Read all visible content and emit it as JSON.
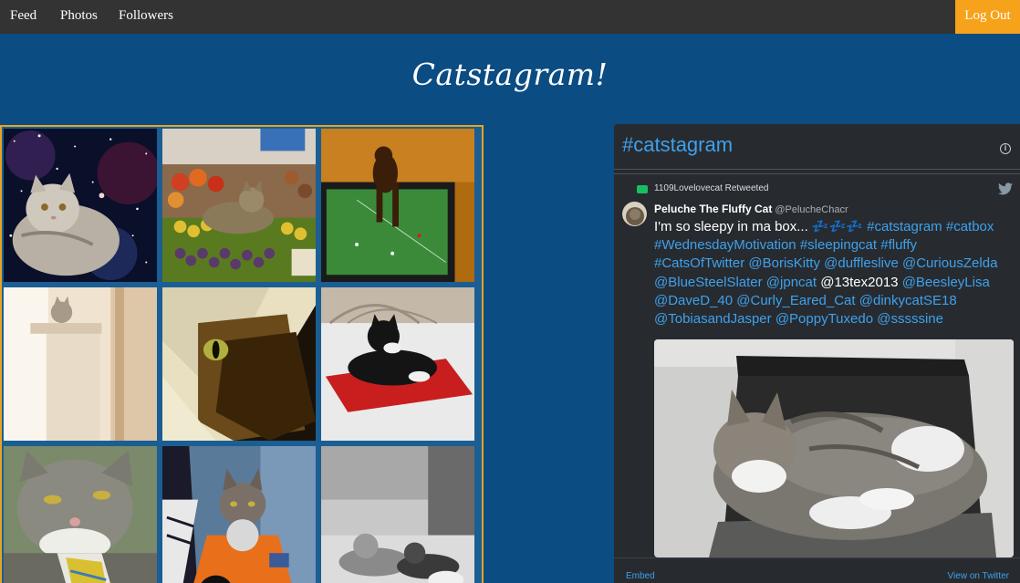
{
  "nav": {
    "items": [
      {
        "label": "Feed"
      },
      {
        "label": "Photos"
      },
      {
        "label": "Followers"
      }
    ],
    "logout_label": "Log Out"
  },
  "site_title": "Catstagram!",
  "photo_grid": {
    "photos": [
      {
        "description": "cat in space"
      },
      {
        "description": "cat on fruit stand"
      },
      {
        "description": "cat on tv"
      },
      {
        "description": "cat in cat tree"
      },
      {
        "description": "cat eye peeking"
      },
      {
        "description": "cat in box"
      },
      {
        "description": "cat with tie"
      },
      {
        "description": "astronaut cat"
      },
      {
        "description": "kittens black and white"
      }
    ]
  },
  "twitter_widget": {
    "title": "#catstagram",
    "retweet_text": "1109Lovelovecat Retweeted",
    "author_name": "Peluche The Fluffy Cat",
    "author_handle": "@PelucheChacr",
    "tweet_segments": [
      {
        "text": "I'm so sleepy in ma box... 💤💤💤 ",
        "link": false
      },
      {
        "text": "#catstagram",
        "link": true
      },
      {
        "text": " ",
        "link": false
      },
      {
        "text": "#catbox",
        "link": true
      },
      {
        "text": " ",
        "link": false
      },
      {
        "text": "#WednesdayMotivation",
        "link": true
      },
      {
        "text": " ",
        "link": false
      },
      {
        "text": "#sleepingcat",
        "link": true
      },
      {
        "text": " ",
        "link": false
      },
      {
        "text": "#fluffy",
        "link": true
      },
      {
        "text": " ",
        "link": false
      },
      {
        "text": "#CatsOfTwitter",
        "link": true
      },
      {
        "text": " ",
        "link": false
      },
      {
        "text": "@BorisKitty",
        "link": true
      },
      {
        "text": " ",
        "link": false
      },
      {
        "text": "@duffleslive",
        "link": true
      },
      {
        "text": " ",
        "link": false
      },
      {
        "text": "@CuriousZelda",
        "link": true
      },
      {
        "text": " ",
        "link": false
      },
      {
        "text": "@BlueSteelSlater",
        "link": true
      },
      {
        "text": " ",
        "link": false
      },
      {
        "text": "@jpncat",
        "link": true
      },
      {
        "text": " @13tex2013 ",
        "link": false
      },
      {
        "text": "@BeesleyLisa",
        "link": true
      },
      {
        "text": " ",
        "link": false
      },
      {
        "text": "@DaveD_40",
        "link": true
      },
      {
        "text": " ",
        "link": false
      },
      {
        "text": "@Curly_Eared_Cat",
        "link": true
      },
      {
        "text": " ",
        "link": false
      },
      {
        "text": "@dinkycatSE18",
        "link": true
      },
      {
        "text": " ",
        "link": false
      },
      {
        "text": "@TobiasandJasper",
        "link": true
      },
      {
        "text": " ",
        "link": false
      },
      {
        "text": "@PoppyTuxedo",
        "link": true
      },
      {
        "text": " ",
        "link": false
      },
      {
        "text": "@sssssine",
        "link": true
      }
    ],
    "embed_label": "Embed",
    "view_on_label": "View on Twitter"
  },
  "colors": {
    "navbar": "#333333",
    "page_bg": "#0b4c82",
    "logout_bg": "#f7a21b",
    "grid_border": "#e8a31f",
    "twitter_link": "#3ea1ec",
    "widget_bg": "#272b30"
  },
  "icons": [
    "info-icon",
    "retweet-icon",
    "twitter-bird-icon"
  ]
}
